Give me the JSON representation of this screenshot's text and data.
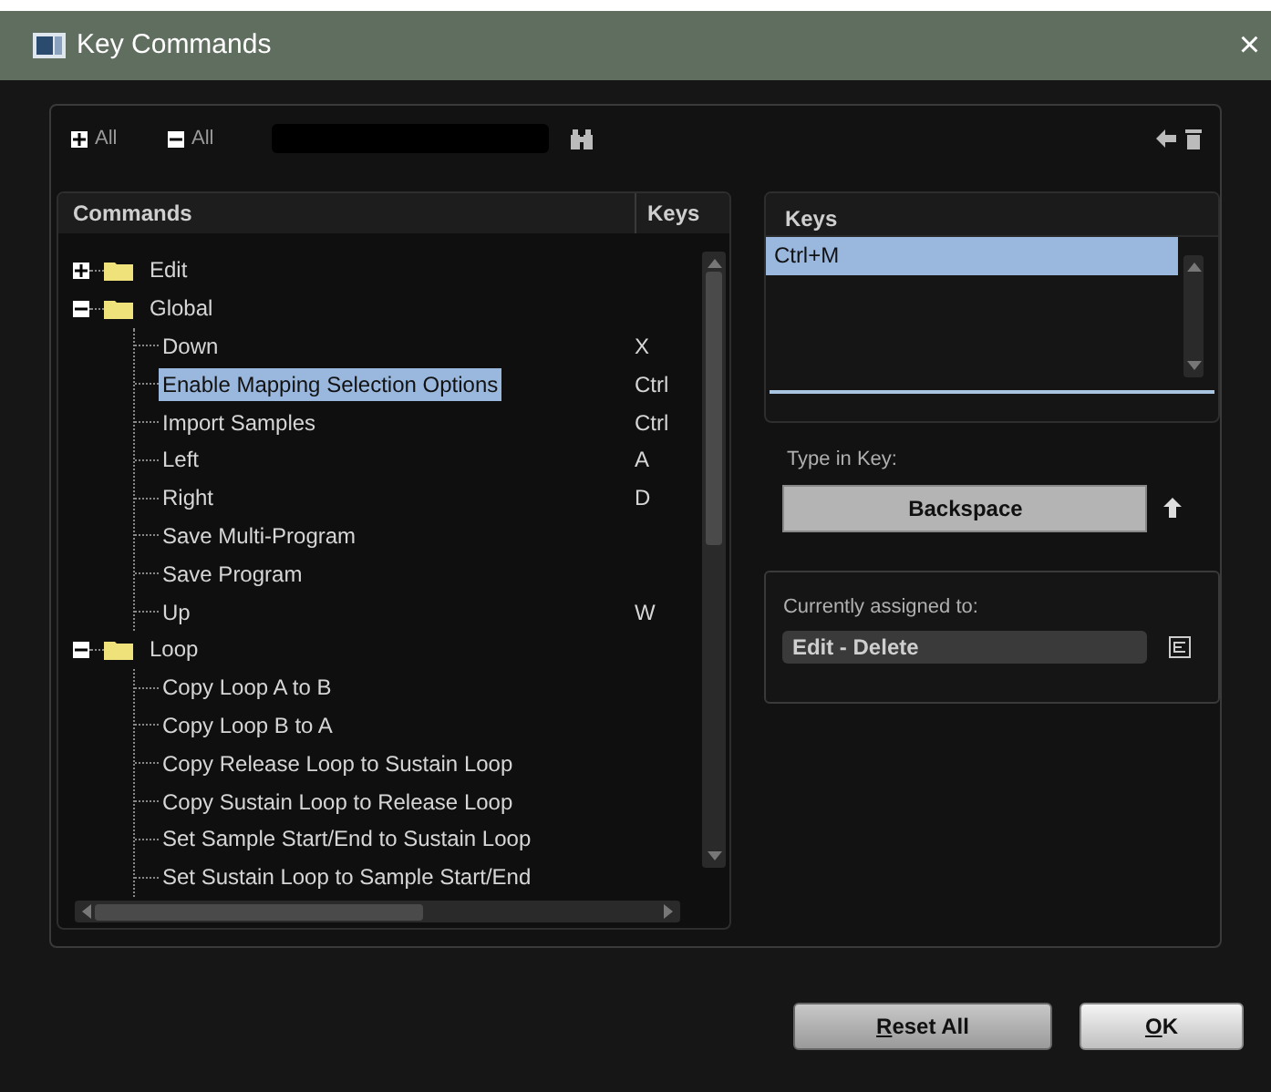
{
  "window": {
    "title": "Key Commands",
    "close": "×"
  },
  "toolbar": {
    "expand_all": "All",
    "collapse_all": "All"
  },
  "commands": {
    "columns": [
      "Commands",
      "Keys"
    ],
    "tree": [
      {
        "label": "Edit",
        "expanded": false,
        "selected": false
      },
      {
        "label": "Global",
        "expanded": true,
        "selected": false,
        "children": [
          {
            "label": "Down",
            "keys": "X",
            "selected": false
          },
          {
            "label": "Enable Mapping Selection Options",
            "keys": "Ctrl",
            "selected": true
          },
          {
            "label": "Import Samples",
            "keys": "Ctrl",
            "selected": false
          },
          {
            "label": "Left",
            "keys": "A",
            "selected": false
          },
          {
            "label": "Right",
            "keys": "D",
            "selected": false
          },
          {
            "label": "Save Multi-Program",
            "selected": false
          },
          {
            "label": "Save Program",
            "selected": false
          },
          {
            "label": "Up",
            "keys": "W",
            "selected": false
          }
        ]
      },
      {
        "label": "Loop",
        "expanded": true,
        "selected": false,
        "children": [
          {
            "label": "Copy Loop A to B",
            "selected": false
          },
          {
            "label": "Copy Loop B to A",
            "selected": false
          },
          {
            "label": "Copy Release Loop to Sustain Loop",
            "selected": false
          },
          {
            "label": "Copy Sustain Loop to Release Loop",
            "selected": false
          },
          {
            "label": "Set Sample Start/End to Sustain Loop",
            "selected": false
          },
          {
            "label": "Set Sustain Loop to Sample Start/End",
            "selected": false
          }
        ]
      }
    ]
  },
  "keys_panel": {
    "heading": "Keys",
    "items": [
      {
        "label": "Ctrl+M",
        "selected": true
      }
    ]
  },
  "type_in_key": {
    "label": "Type in Key:",
    "value": "Backspace"
  },
  "assigned": {
    "label": "Currently assigned to:",
    "value": "Edit - Delete"
  },
  "buttons": [
    {
      "label": "Reset All",
      "mnemonic_first": true,
      "kind": "normal"
    },
    {
      "label": "OK",
      "mnemonic_first": true,
      "kind": "default"
    }
  ]
}
